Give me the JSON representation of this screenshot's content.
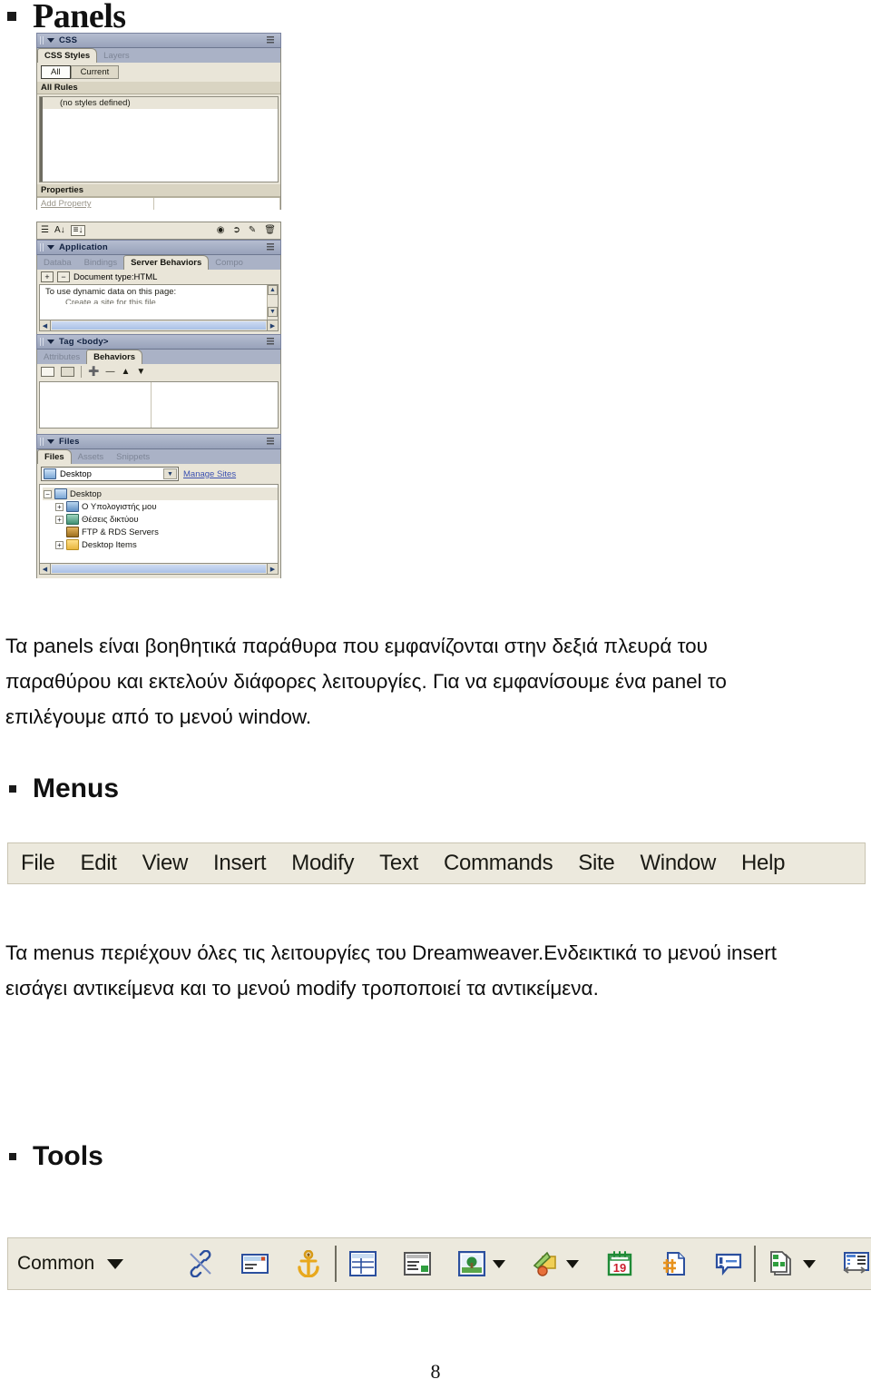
{
  "document": {
    "page_number": "8",
    "headings": {
      "panels": "Panels",
      "menus": "Menus",
      "tools": "Tools"
    },
    "paragraphs": {
      "panels": "Τα panels είναι βοηθητικά παράθυρα που εμφανίζονται στην δεξιά πλευρά του παραθύρου και εκτελούν διάφορες λειτουργίες. Για να εμφανίσουμε ένα panel το επιλέγουμε από το μενού window.",
      "menus": "Τα menus περιέχουν όλες τις λειτουργίες του Dreamweaver.Ενδεικτικά το μενού insert εισάγει αντικείμενα και το μενού modify τροποποιεί τα αντικείμενα."
    }
  },
  "colors": {
    "panel_titlebar": "#a7b0c6",
    "panel_body": "#e9e5d8",
    "toolbar_bg": "#ece9dd",
    "link": "#3a4fb0",
    "text": "#15150f"
  },
  "panels_screenshot": {
    "css_panel": {
      "title": "CSS",
      "tabs": [
        {
          "label": "CSS Styles",
          "active": true
        },
        {
          "label": "Layers",
          "active": false
        }
      ],
      "buttons": [
        {
          "label": "All",
          "selected": true
        },
        {
          "label": "Current",
          "selected": false
        }
      ],
      "rules_header": "All Rules",
      "rules_empty_item": "(no styles defined)",
      "properties_header": "Properties",
      "add_property": "Add Property"
    },
    "css_property_toolbar": {
      "icons": [
        "show-category-view-icon",
        "show-list-view-alpha-icon",
        "show-only-set-properties-icon",
        "attach-style-sheet-icon",
        "new-css-rule-icon",
        "edit-style-icon",
        "delete-css-rule-icon"
      ]
    },
    "application_panel": {
      "title": "Application",
      "tabs": [
        {
          "label": "Databa",
          "active": false
        },
        {
          "label": "Bindings",
          "active": false
        },
        {
          "label": "Server Behaviors",
          "active": true
        },
        {
          "label": "Compo",
          "active": false
        }
      ],
      "add_button": "+",
      "remove_button": "−",
      "document_type": "Document type:HTML",
      "hint_text": "To use dynamic data on this page:",
      "hint_bullet_clipped": "Create a site for this file"
    },
    "tag_panel": {
      "title": "Tag <body>",
      "tabs": [
        {
          "label": "Attributes",
          "active": false
        },
        {
          "label": "Behaviors",
          "active": true
        }
      ],
      "toolbar_icons": [
        "show-set-events-icon",
        "show-all-events-icon",
        "add-behavior-icon",
        "remove-behavior-icon",
        "move-up-icon",
        "move-down-icon"
      ]
    },
    "files_panel": {
      "title": "Files",
      "tabs": [
        {
          "label": "Files",
          "active": true
        },
        {
          "label": "Assets",
          "active": false
        },
        {
          "label": "Snippets",
          "active": false
        }
      ],
      "site_selector_value": "Desktop",
      "manage_sites_link": "Manage Sites",
      "tree": [
        {
          "label": "Desktop",
          "icon": "desktop-icon",
          "expander": "−",
          "level": 0,
          "selected": true
        },
        {
          "label": "Ο Υπολογιστής μου",
          "icon": "my-computer-icon",
          "expander": "+",
          "level": 1
        },
        {
          "label": "Θέσεις δικτύου",
          "icon": "network-places-icon",
          "expander": "+",
          "level": 1
        },
        {
          "label": "FTP & RDS Servers",
          "icon": "ftp-servers-icon",
          "expander": "",
          "level": 1
        },
        {
          "label": "Desktop Items",
          "icon": "folder-icon",
          "expander": "+",
          "level": 1
        }
      ]
    }
  },
  "menu_bar": {
    "items": [
      "File",
      "Edit",
      "View",
      "Insert",
      "Modify",
      "Text",
      "Commands",
      "Site",
      "Window",
      "Help"
    ]
  },
  "insert_bar": {
    "category": "Common",
    "category_caret": "chevron-down-icon",
    "items": [
      {
        "name": "hyperlink-icon",
        "has_dropdown": false
      },
      {
        "name": "email-link-icon",
        "has_dropdown": false
      },
      {
        "name": "named-anchor-icon",
        "has_dropdown": false
      },
      {
        "name": "table-icon",
        "has_dropdown": false,
        "group_start": true
      },
      {
        "name": "insert-div-tag-icon",
        "has_dropdown": false
      },
      {
        "name": "image-icon",
        "has_dropdown": true
      },
      {
        "name": "media-flash-icon",
        "has_dropdown": true
      },
      {
        "name": "date-icon",
        "has_dropdown": false
      },
      {
        "name": "server-side-include-icon",
        "has_dropdown": false
      },
      {
        "name": "comment-icon",
        "has_dropdown": false
      },
      {
        "name": "templates-icon",
        "has_dropdown": true,
        "group_start": true
      },
      {
        "name": "tag-chooser-icon",
        "has_dropdown": false
      }
    ]
  }
}
